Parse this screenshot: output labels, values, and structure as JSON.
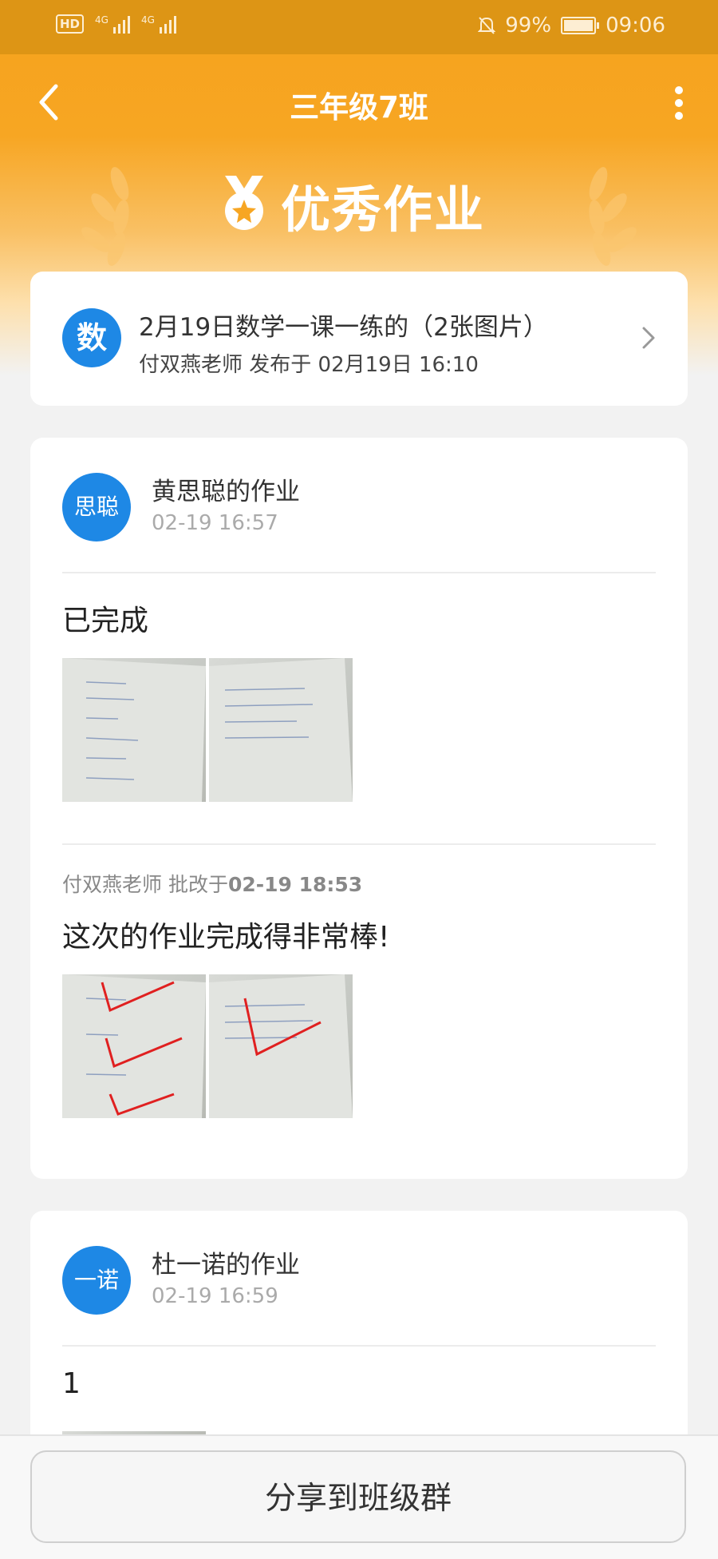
{
  "status_bar": {
    "hd": "HD",
    "sim1": "4G",
    "sim2": "4G",
    "battery": "99%",
    "time": "09:06"
  },
  "nav": {
    "title": "三年级7班"
  },
  "banner": {
    "title": "优秀作业"
  },
  "assignment": {
    "subject_badge": "数",
    "title": "2月19日数学一课一练的（2张图片）",
    "subtitle": "付双燕老师 发布于 02月19日 16:10"
  },
  "submissions": [
    {
      "avatar": "思聪",
      "name": "黄思聪的作业",
      "time": "02-19 16:57",
      "content": "已完成",
      "review": {
        "teacher": "付双燕老师 批改于",
        "time": "02-19 18:53",
        "comment": "这次的作业完成得非常棒!"
      }
    },
    {
      "avatar": "一诺",
      "name": "杜一诺的作业",
      "time": "02-19 16:59",
      "content": "1"
    }
  ],
  "bottom": {
    "share_label": "分享到班级群"
  }
}
